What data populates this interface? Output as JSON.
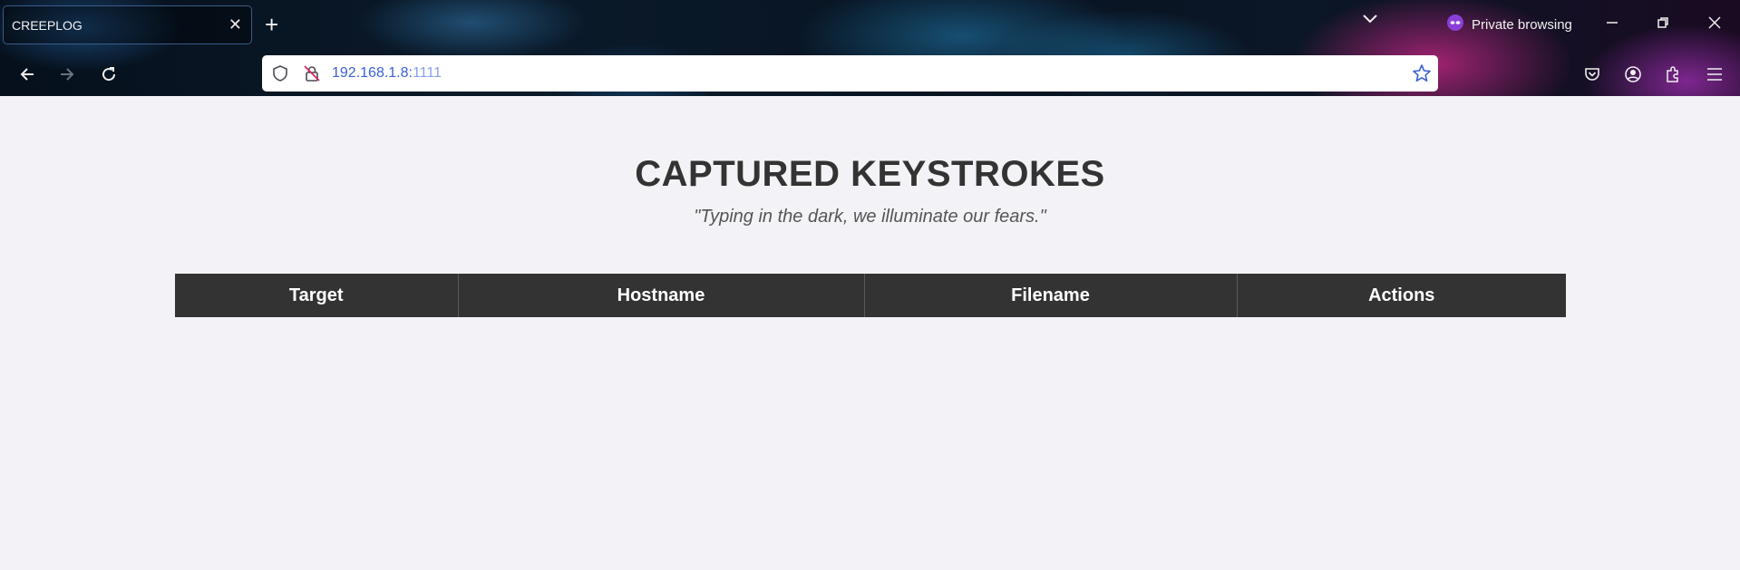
{
  "browser": {
    "tab": {
      "title": "CREEPLOG",
      "close_symbol": "✕"
    },
    "new_tab_symbol": "+",
    "private_label": "Private browsing",
    "url": {
      "host": "192.168.1.8:",
      "port": "1111"
    }
  },
  "page": {
    "title": "CAPTURED KEYSTROKES",
    "quote": "\"Typing in the dark, we illuminate our fears.\""
  },
  "table": {
    "columns": [
      "Target",
      "Hostname",
      "Filename",
      "Actions"
    ]
  },
  "colors": {
    "page_bg": "#f3f3f7",
    "table_header_bg": "#333333",
    "url_text": "#3b5fd6"
  }
}
